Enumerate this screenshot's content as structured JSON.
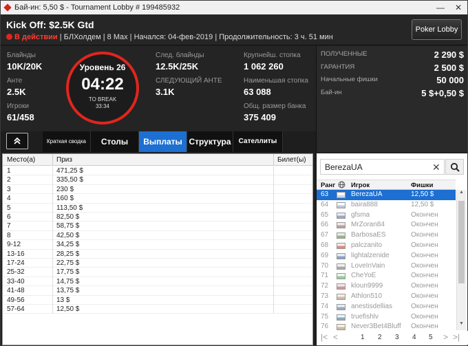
{
  "window": {
    "title": "Бай-ин: 5,50 $ - Tournament Lobby # 199485932",
    "minimize": "—",
    "close": "✕"
  },
  "header": {
    "tournament_name": "Kick Off: $2.5K Gtd",
    "status": "В действии",
    "info": "| БЛХолдем | 8 Max | Начался: 04-фев-2019 | Продолжительность: 3 ч. 51 мин",
    "lobby_button": "Poker Lobby"
  },
  "stats": {
    "blinds_label": "Блайнды",
    "blinds": "10K/20K",
    "ante_label": "Анте",
    "ante": "2.5K",
    "players_label": "Игроки",
    "players": "61/458",
    "next_blinds_label": "След. блайнды",
    "next_blinds": "12.5K/25K",
    "next_ante_label": "СЛЕДУЮЩИЙ АНТЕ",
    "next_ante": "3.1K",
    "largest_stack_label": "Крупнейш. стопка",
    "largest_stack": "1 062 260",
    "avg_stack_label": "Наименьшая стопка",
    "avg_stack": "63 088",
    "total_bank_label": "Общ. размер банка",
    "total_bank": "375 409"
  },
  "clock": {
    "level": "Уровень 26",
    "time": "04:22",
    "break_label": "TO BREAK",
    "break_time": "33:34",
    "accent": "#e0261d"
  },
  "prize_panel": {
    "rows": [
      {
        "label": "ПОЛУЧЕННЫЕ",
        "value": "2 290 $"
      },
      {
        "label": "ГАРАНТИЯ",
        "value": "2 500 $"
      },
      {
        "label": "Начальные фишки",
        "value": "50 000"
      },
      {
        "label": "Бай-ин",
        "value": "5 $+0,50 $"
      }
    ]
  },
  "tabs": {
    "collapse_icon": "chevron-up-double",
    "summary": "Краткая сводка",
    "tables": "Столы",
    "payouts": "Выплаты",
    "structure": "Структура",
    "satellites": "Сателлиты",
    "active_color": "#1d6fd1"
  },
  "payout": {
    "headers": [
      "Место(а)",
      "Приз",
      "Билет(ы)"
    ],
    "rows": [
      [
        "1",
        "471,25 $"
      ],
      [
        "2",
        "335,50 $"
      ],
      [
        "3",
        "230 $"
      ],
      [
        "4",
        "160 $"
      ],
      [
        "5",
        "113,50 $"
      ],
      [
        "6",
        "82,50 $"
      ],
      [
        "7",
        "58,75 $"
      ],
      [
        "8",
        "42,50 $"
      ],
      [
        "9-12",
        "34,25 $"
      ],
      [
        "13-16",
        "28,25 $"
      ],
      [
        "17-24",
        "22,75 $"
      ],
      [
        "25-32",
        "17,75 $"
      ],
      [
        "33-40",
        "14,75 $"
      ],
      [
        "41-48",
        "13,75 $"
      ],
      [
        "49-56",
        "13 $"
      ],
      [
        "57-64",
        "12,50 $"
      ]
    ]
  },
  "players": {
    "search_value": "BerezaUA",
    "headers": {
      "rank": "Ранг",
      "globe_icon": "globe-icon",
      "player": "Игрок",
      "chips": "Фишки"
    },
    "rows": [
      {
        "rank": "63",
        "name": "BerezaUA",
        "chips": "12,50 $",
        "selected": true
      },
      {
        "rank": "64",
        "name": "baira888",
        "chips": "12,50 $"
      },
      {
        "rank": "65",
        "name": "gfsma",
        "chips": "Окончен"
      },
      {
        "rank": "66",
        "name": "MrZoran84",
        "chips": "Окончен"
      },
      {
        "rank": "67",
        "name": "BarbosaES",
        "chips": "Окончен"
      },
      {
        "rank": "68",
        "name": "palczanito",
        "chips": "Окончен"
      },
      {
        "rank": "69",
        "name": "lightalzenide",
        "chips": "Окончен"
      },
      {
        "rank": "70",
        "name": "LoveInVain",
        "chips": "Окончен"
      },
      {
        "rank": "71",
        "name": "CheYoE",
        "chips": "Окончен"
      },
      {
        "rank": "72",
        "name": "kloun9999",
        "chips": "Окончен"
      },
      {
        "rank": "73",
        "name": "Athlon510",
        "chips": "Окончен"
      },
      {
        "rank": "74",
        "name": "anestisdellias",
        "chips": "Окончен"
      },
      {
        "rank": "75",
        "name": "truefishlv",
        "chips": "Окончен"
      },
      {
        "rank": "76",
        "name": "Never3Bet4Bluff",
        "chips": "Окончен"
      }
    ],
    "pager": {
      "first": "|<",
      "prev": "<",
      "pages": [
        "1",
        "2",
        "3",
        "4",
        "5"
      ],
      "next": ">",
      "last": ">|"
    }
  }
}
